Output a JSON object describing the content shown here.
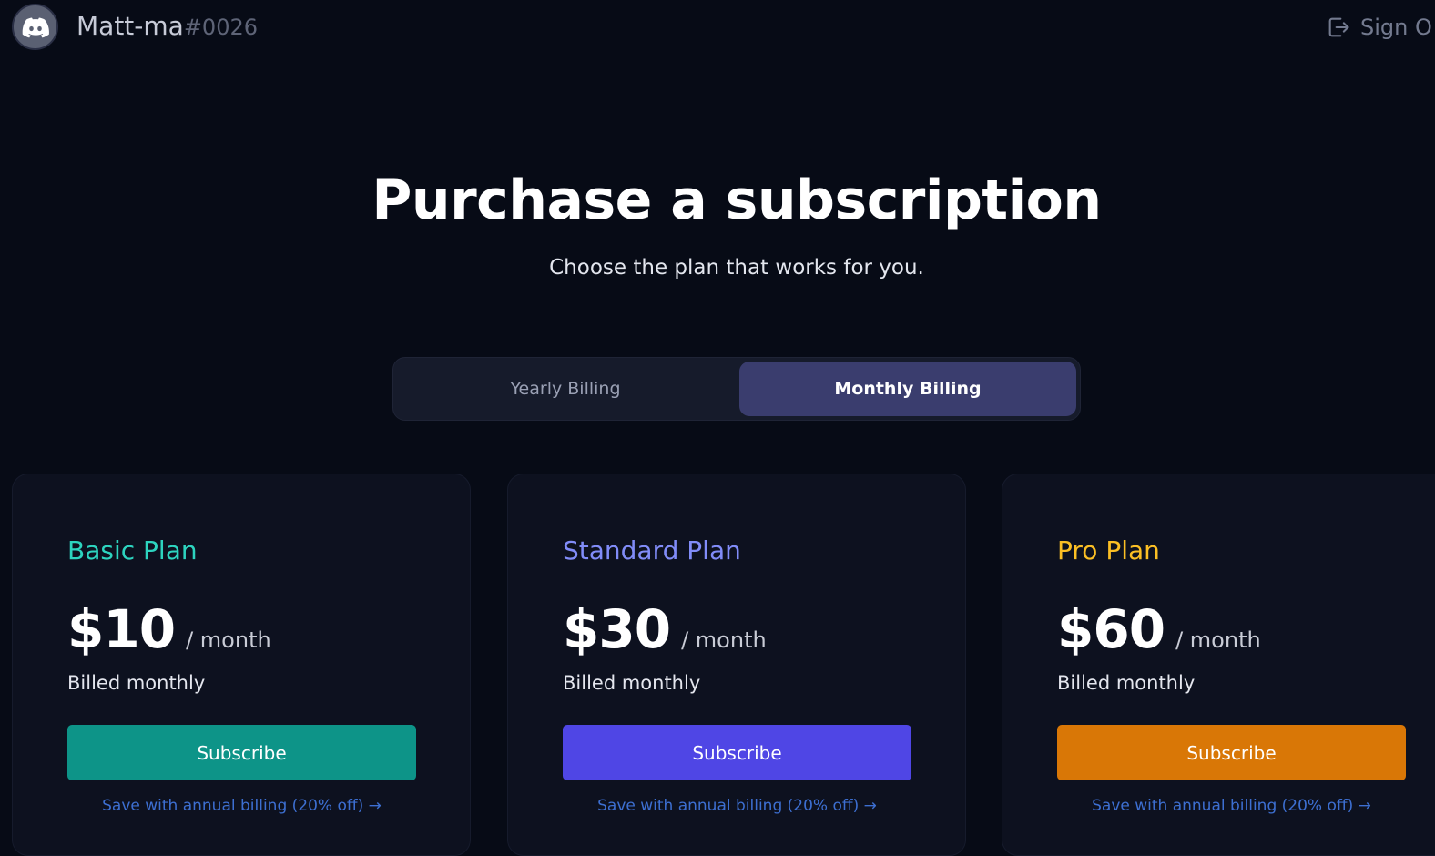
{
  "header": {
    "username": "Matt-ma",
    "discriminator": "#0026",
    "avatar_icon": "discord-logo-icon",
    "signout_icon": "sign-out-icon",
    "signout_label": "Sign O"
  },
  "hero": {
    "title": "Purchase a subscription",
    "subtitle": "Choose the plan that works for you."
  },
  "billing_toggle": {
    "options": [
      {
        "label": "Yearly Billing",
        "selected": false
      },
      {
        "label": "Monthly Billing",
        "selected": true
      }
    ]
  },
  "plans": [
    {
      "name": "Basic Plan",
      "price": "$10",
      "period": "/ month",
      "billed": "Billed monthly",
      "button_label": "Subscribe",
      "save_link": "Save with annual billing (20% off) →",
      "accent_color": "#2dd4bf",
      "button_color": "#0d9488"
    },
    {
      "name": "Standard Plan",
      "price": "$30",
      "period": "/ month",
      "billed": "Billed monthly",
      "button_label": "Subscribe",
      "save_link": "Save with annual billing (20% off) →",
      "accent_color": "#818cf8",
      "button_color": "#4f46e5"
    },
    {
      "name": "Pro Plan",
      "price": "$60",
      "period": "/ month",
      "billed": "Billed monthly",
      "button_label": "Subscribe",
      "save_link": "Save with annual billing (20% off) →",
      "accent_color": "#fbbf24",
      "button_color": "#d97706"
    }
  ],
  "colors": {
    "background": "#070b16",
    "card_background": "#0d111f",
    "toggle_selected": "#3a3d6e",
    "link": "#3d6fd1"
  }
}
